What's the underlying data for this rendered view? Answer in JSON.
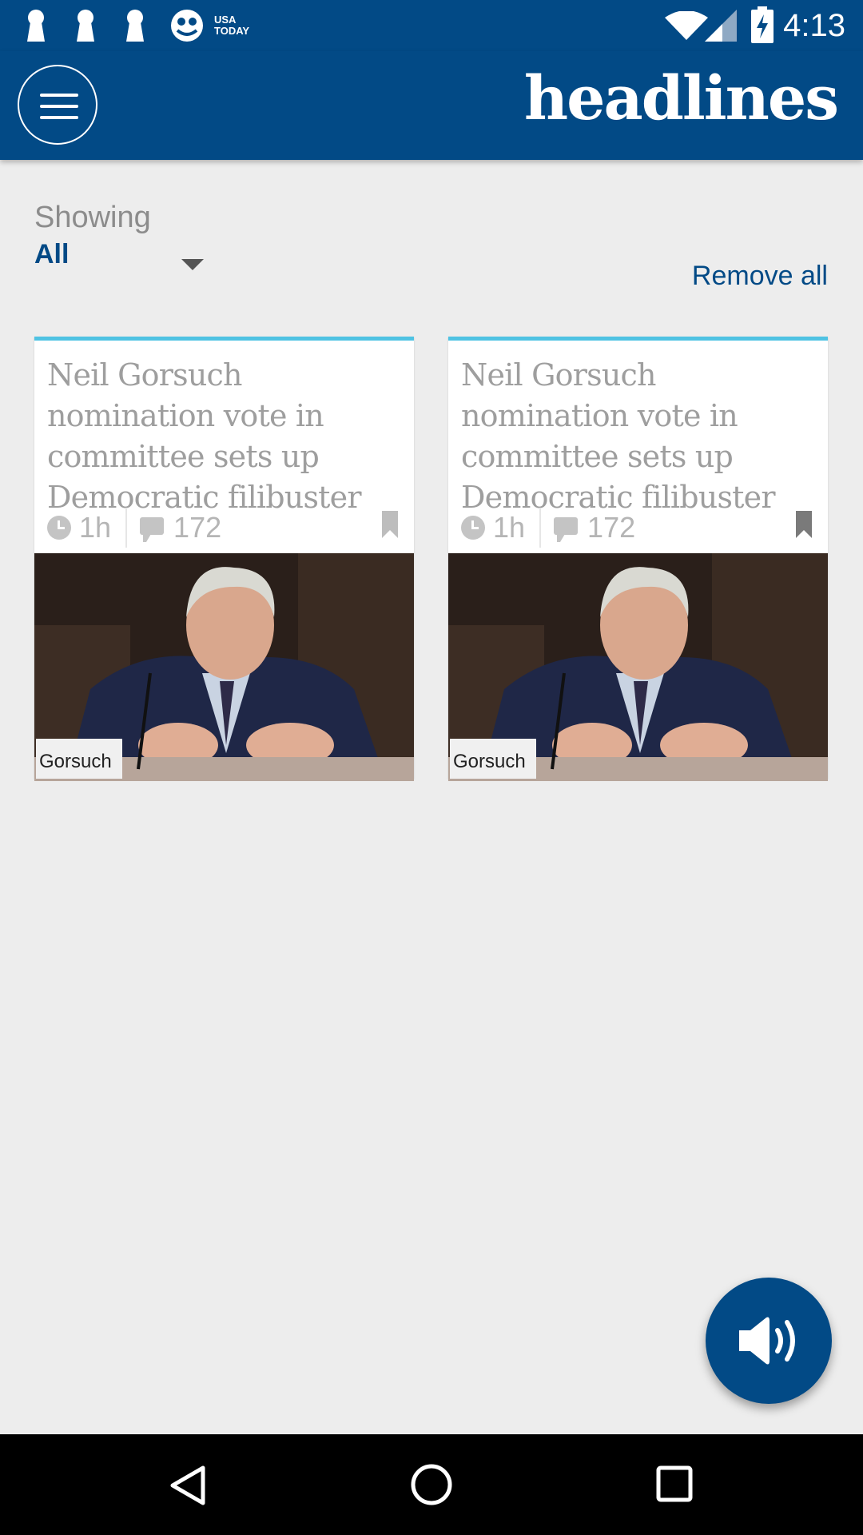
{
  "status_bar": {
    "time": "4:13",
    "notification_icons": [
      "keyhole-icon",
      "keyhole-icon",
      "keyhole-icon",
      "usa-today-icon"
    ],
    "usa_today_label_line1": "USA",
    "usa_today_label_line2": "TODAY",
    "system_icons": [
      "wifi-icon",
      "signal-icon",
      "battery-charging-icon"
    ]
  },
  "app_bar": {
    "title": "headlines",
    "menu_icon": "hamburger-menu-icon",
    "background": "#024a86"
  },
  "filter": {
    "label": "Showing",
    "selected_value": "All"
  },
  "remove_all_label": "Remove all",
  "cards": [
    {
      "headline": "Neil Gorsuch nomination vote in committee sets up Democratic filibuster",
      "age": "1h",
      "comments": "172",
      "nameplate": "Gorsuch",
      "bookmarked": false
    },
    {
      "headline": "Neil Gorsuch nomination vote in committee sets up Democratic filibuster",
      "age": "1h",
      "comments": "172",
      "nameplate": "Gorsuch",
      "bookmarked": true
    }
  ],
  "fab": {
    "icon": "speaker-volume-icon"
  },
  "nav_bar": {
    "icons": [
      "back-icon",
      "home-icon",
      "recents-icon"
    ]
  },
  "colors": {
    "accent": "#024a86",
    "card_top_border": "#4fc3e3",
    "background": "#ededed"
  }
}
